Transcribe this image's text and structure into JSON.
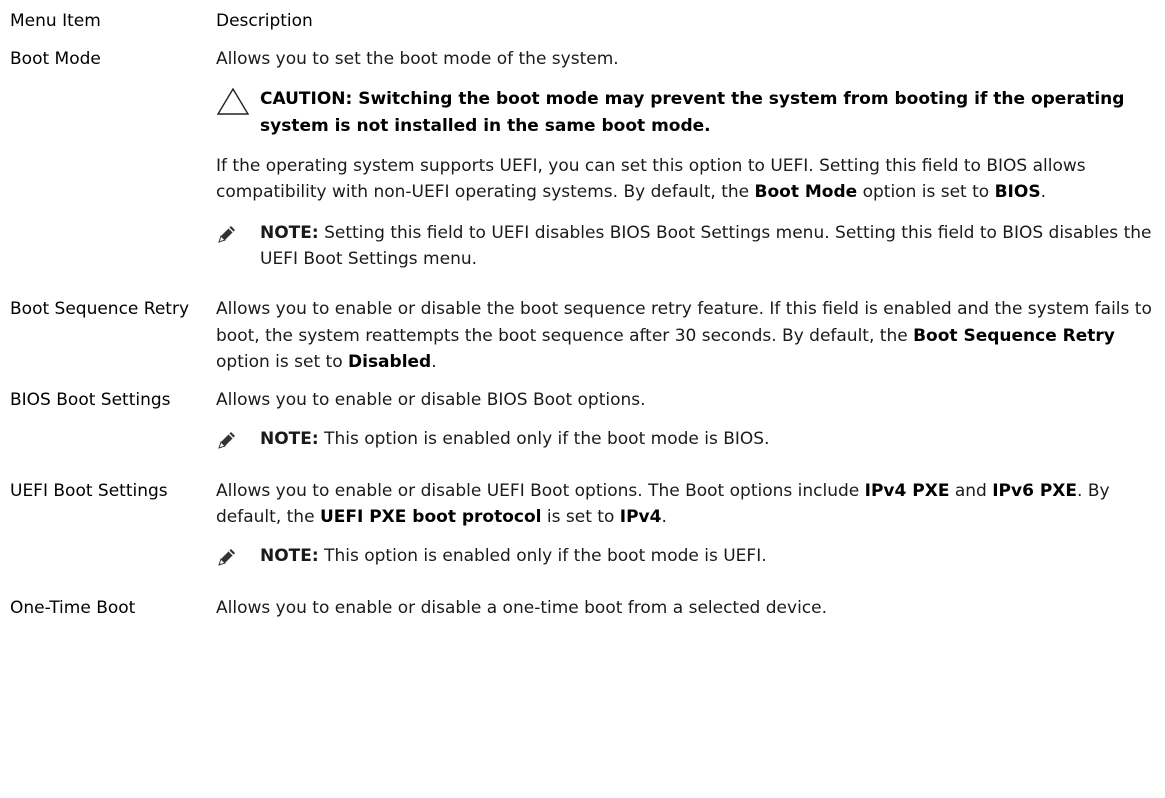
{
  "header": {
    "menu_item": "Menu Item",
    "description": "Description"
  },
  "rows": [
    {
      "item": "Boot Mode",
      "intro": "Allows you to set the boot mode of the system.",
      "caution": "CAUTION: Switching the boot mode may prevent the system from booting if the operating system is not installed in the same boot mode.",
      "body": {
        "t1": "If the operating system supports UEFI, you can set this option to UEFI. Setting this field to BIOS allows compatibility with non-UEFI operating systems. By default, the ",
        "b1": "Boot Mode",
        "t2": " option is set to ",
        "b2": "BIOS",
        "t3": "."
      },
      "note": {
        "label": "NOTE:",
        "text": " Setting this field to UEFI disables BIOS Boot Settings menu. Setting this field to BIOS disables the UEFI Boot Settings menu."
      }
    },
    {
      "item": "Boot Sequence Retry",
      "body": {
        "t1": "Allows you to enable or disable the boot sequence retry feature. If this field is enabled and the system fails to boot, the system reattempts the boot sequence after 30 seconds. By default, the ",
        "b1": "Boot Sequence Retry",
        "t2": " option is set to ",
        "b2": "Disabled",
        "t3": "."
      }
    },
    {
      "item": "BIOS Boot Settings",
      "intro": "Allows you to enable or disable BIOS Boot options.",
      "note": {
        "label": "NOTE:",
        "text": " This option is enabled only if the boot mode is BIOS."
      }
    },
    {
      "item": "UEFI Boot Settings",
      "body": {
        "t1": "Allows you to enable or disable UEFI Boot options. The Boot options include ",
        "b1": "IPv4 PXE",
        "t2": " and ",
        "b2": "IPv6 PXE",
        "t3": ". By default, the ",
        "b3": "UEFI PXE boot protocol",
        "t4": " is set to ",
        "b4": "IPv4",
        "t5": "."
      },
      "note": {
        "label": "NOTE:",
        "text": " This option is enabled only if the boot mode is UEFI."
      }
    },
    {
      "item": "One-Time Boot",
      "intro": "Allows you to enable or disable a one-time boot from a selected device."
    }
  ]
}
